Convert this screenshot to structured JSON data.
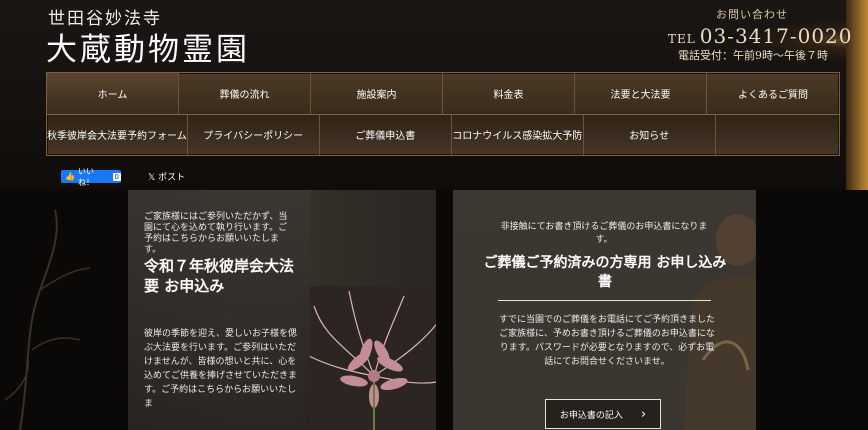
{
  "header": {
    "temple_name": "世田谷妙法寺",
    "site_title": "大蔵動物霊園",
    "contact_label": "お問い合わせ",
    "tel_prefix": "TEL",
    "tel_number": "03-3417-0020",
    "tel_hours": "電話受付：午前9時〜午後７時"
  },
  "nav": {
    "row1": [
      "ホーム",
      "葬儀の流れ",
      "施設案内",
      "料金表",
      "法要と大法要",
      "よくあるご質問"
    ],
    "row2": [
      "秋季彼岸会大法要予約フォーム",
      "プライバシーポリシー",
      "ご葬儀申込書",
      "コロナウイルス感染拡大予防",
      "お知らせ",
      ""
    ]
  },
  "social": {
    "like_label": "いいね！",
    "like_count": "0",
    "post_label": "ポスト"
  },
  "left_card": {
    "intro": "ご家族様にはご参列いただかず、当園にて心を込めて執り行います。ご予約はこちらからお願いいたします。",
    "title": "令和７年秋彼岸会大法要 お申込み",
    "body": "彼岸の季節を迎え、愛しいお子様を偲ぶ大法要を行います。ご参列はいただけませんが、皆様の想いと共に、心を込めてご供養を捧げさせていただきます。ご予約はこちらからお願いいたしま"
  },
  "right_card": {
    "intro": "非接触にてお書き頂けるご葬儀のお申込書になります。",
    "title": "ご葬儀ご予約済みの方専用 お申し込み書",
    "body": "すでに当園でのご葬儀をお電話にてご予約頂きましたご家族様に、予めお書き頂けるご葬儀のお申込書になります。パスワードが必要となりますので、必ずお電話にてお問合せくださいませ。",
    "button_label": "お申込書の記入"
  },
  "colors": {
    "nav_bg": "#3a2c1c",
    "fb_blue": "#1877f2",
    "card_bg": "#3c3731"
  }
}
